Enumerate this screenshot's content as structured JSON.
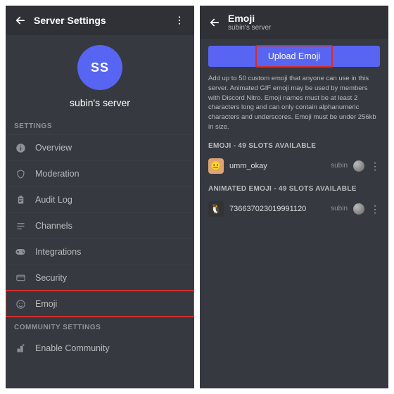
{
  "left": {
    "title": "Server Settings",
    "avatar_text": "SS",
    "server_name": "subin's server",
    "section1": "SETTINGS",
    "items": [
      {
        "icon": "info",
        "label": "Overview"
      },
      {
        "icon": "shield",
        "label": "Moderation"
      },
      {
        "icon": "clipboard",
        "label": "Audit Log"
      },
      {
        "icon": "list",
        "label": "Channels"
      },
      {
        "icon": "gamepad",
        "label": "Integrations"
      },
      {
        "icon": "security",
        "label": "Security"
      },
      {
        "icon": "emoji",
        "label": "Emoji"
      }
    ],
    "section2": "COMMUNITY SETTINGS",
    "community_item": {
      "icon": "community",
      "label": "Enable Community"
    }
  },
  "right": {
    "title": "Emoji",
    "subtitle": "subin's server",
    "upload_label": "Upload Emoji",
    "description": "Add up to 50 custom emoji that anyone can use in this server. Animated GIF emoji may be used by members with Discord Nitro. Emoji names must be at least 2 characters long and can only contain alphanumeric characters and underscores. Emoji must be under 256kb in size.",
    "slots1": "EMOJI - 49 SLOTS AVAILABLE",
    "emoji1": {
      "name": "umm_okay",
      "uploader": "subin"
    },
    "slots2": "ANIMATED EMOJI - 49 SLOTS AVAILABLE",
    "emoji2": {
      "name": "736637023019991120",
      "uploader": "subin"
    }
  }
}
